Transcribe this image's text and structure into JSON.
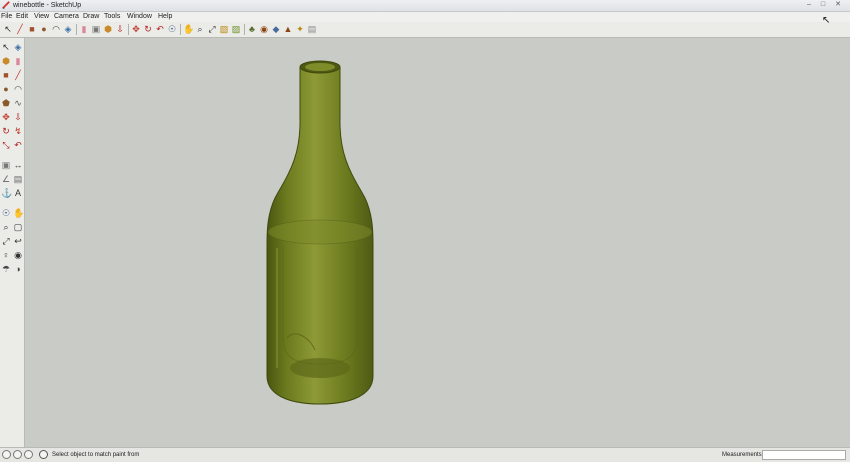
{
  "window": {
    "title": "winebottle - SketchUp",
    "app_icon": "sketchup-logo-icon"
  },
  "window_controls": {
    "minimize": "–",
    "maximize": "□",
    "close": "✕"
  },
  "menu": [
    "File",
    "Edit",
    "View",
    "Camera",
    "Draw",
    "Tools",
    "Window",
    "Help"
  ],
  "toolbar_icons": [
    {
      "name": "select-arrow-icon",
      "glyph": "↖",
      "color": "#333333"
    },
    {
      "name": "pencil-line-icon",
      "glyph": "╱",
      "color": "#c0392b"
    },
    {
      "name": "rectangle-icon",
      "glyph": "■",
      "color": "#a0522d"
    },
    {
      "name": "circle-icon",
      "glyph": "●",
      "color": "#8b5a2b"
    },
    {
      "name": "arc-icon",
      "glyph": "◠",
      "color": "#444444"
    },
    {
      "name": "make-component-icon",
      "glyph": "◈",
      "color": "#3a6ea5"
    },
    {
      "name": "eraser-icon",
      "glyph": "▮",
      "color": "#d98899"
    },
    {
      "name": "tape-measure-icon",
      "glyph": "▣",
      "color": "#777777"
    },
    {
      "name": "paint-bucket-icon",
      "glyph": "⬢",
      "color": "#c98b2a"
    },
    {
      "name": "push-pull-icon",
      "glyph": "⇩",
      "color": "#b22222"
    },
    {
      "name": "move-icon",
      "glyph": "✥",
      "color": "#c0392b"
    },
    {
      "name": "rotate-icon",
      "glyph": "↻",
      "color": "#b22222"
    },
    {
      "name": "offset-icon",
      "glyph": "↶",
      "color": "#b22222"
    },
    {
      "name": "orbit-icon",
      "glyph": "☉",
      "color": "#2f4f7f"
    },
    {
      "name": "pan-icon",
      "glyph": "✋",
      "color": "#7a5c3a"
    },
    {
      "name": "zoom-icon",
      "glyph": "⌕",
      "color": "#333333"
    },
    {
      "name": "zoom-extents-icon",
      "glyph": "⤢",
      "color": "#333333"
    },
    {
      "name": "previous-view-icon",
      "glyph": "▧",
      "color": "#b8860b"
    },
    {
      "name": "next-view-icon",
      "glyph": "▨",
      "color": "#6b8e23"
    },
    {
      "name": "place-model-icon",
      "glyph": "♣",
      "color": "#556b2f"
    },
    {
      "name": "get-models-icon",
      "glyph": "◉",
      "color": "#8b4513"
    },
    {
      "name": "share-model-icon",
      "glyph": "◆",
      "color": "#4a6a9a"
    },
    {
      "name": "share-component-icon",
      "glyph": "▲",
      "color": "#8b4513"
    },
    {
      "name": "extension-warehouse-icon",
      "glyph": "✦",
      "color": "#b8860b"
    },
    {
      "name": "layout-icon",
      "glyph": "▤",
      "color": "#888888"
    }
  ],
  "side_tools": [
    [
      "select-arrow-icon",
      "make-component-icon"
    ],
    [
      "paint-bucket-icon",
      "eraser-icon"
    ],
    [
      "rectangle-icon",
      "line-icon"
    ],
    [
      "circle-icon",
      "arc-icon"
    ],
    [
      "polygon-icon",
      "freehand-icon"
    ],
    [
      "move-icon",
      "push-pull-icon"
    ],
    [
      "rotate-icon",
      "follow-me-icon"
    ],
    [
      "scale-icon",
      "offset-icon"
    ],
    [
      "tape-measure-icon",
      "dimension-icon"
    ],
    [
      "protractor-icon",
      "text-icon"
    ],
    [
      "axes-icon",
      "3d-text-icon"
    ],
    [
      "orbit-icon",
      "pan-icon"
    ],
    [
      "zoom-icon",
      "zoom-window-icon"
    ],
    [
      "zoom-extents-icon",
      "previous-view-icon"
    ],
    [
      "position-camera-icon",
      "look-around-icon"
    ],
    [
      "walk-icon",
      "section-plane-icon"
    ]
  ],
  "side_tool_glyphs": [
    "↖",
    "◈",
    "⬢",
    "▮",
    "■",
    "╱",
    "●",
    "◠",
    "⬟",
    "∿",
    "✥",
    "⇩",
    "↻",
    "↯",
    "⤡",
    "↶",
    "▣",
    "↔",
    "∠",
    "▤",
    "⚓",
    "A",
    "☉",
    "✋",
    "⌕",
    "▢",
    "⤢",
    "↩",
    "♀",
    "◉",
    "☂",
    "◑"
  ],
  "side_tool_colors": [
    "#333333",
    "#3a6ea5",
    "#c98b2a",
    "#d98899",
    "#a0522d",
    "#c0392b",
    "#8b5a2b",
    "#444444",
    "#8b5a2b",
    "#555555",
    "#c0392b",
    "#b22222",
    "#b22222",
    "#c0392b",
    "#b22222",
    "#b22222",
    "#777777",
    "#444444",
    "#666666",
    "#666666",
    "#aa3333",
    "#333333",
    "#2f4f7f",
    "#7a5c3a",
    "#333333",
    "#333333",
    "#333333",
    "#333333",
    "#333333",
    "#333333",
    "#444444",
    "#444444"
  ],
  "model": {
    "name": "wine bottle",
    "glass_color": "#6b7a1e",
    "highlight_color": "#8e9a36",
    "shadow_color": "#4a5510"
  },
  "status": {
    "icons": [
      "geo-location-icon",
      "credits-icon",
      "help-icon"
    ],
    "message": "Select object to match paint from",
    "measurements_label": "Measurements",
    "measurements_value": ""
  },
  "colors": {
    "viewport_bg": "#c9cbc6",
    "toolbar_bg": "#ebebe8"
  }
}
